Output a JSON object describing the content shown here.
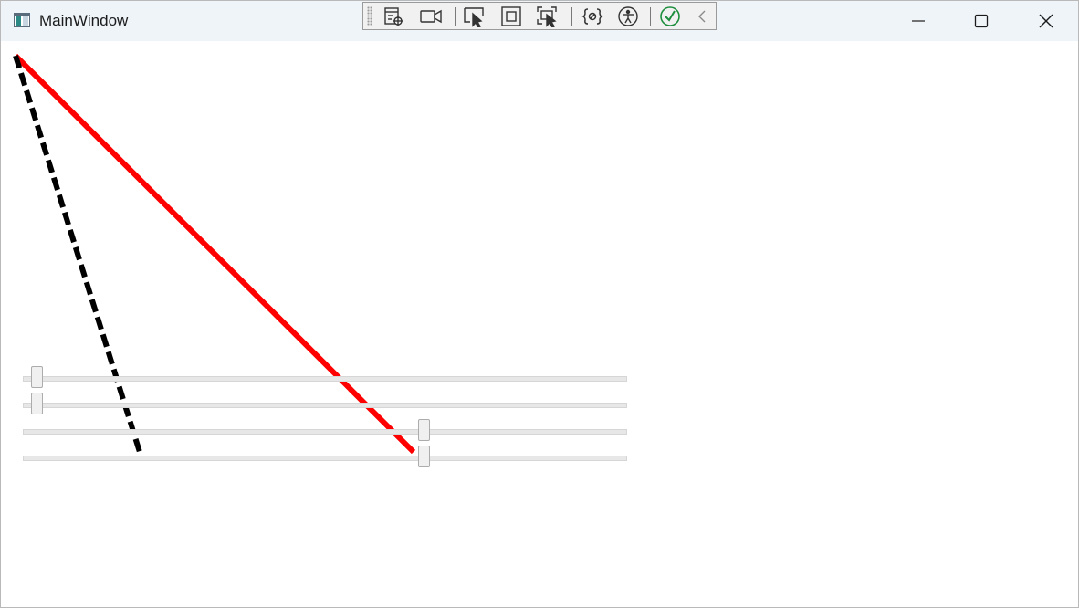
{
  "window": {
    "title": "MainWindow",
    "icon": "wpf-app-icon"
  },
  "caption_buttons": {
    "minimize": "minimize-icon",
    "maximize": "maximize-icon",
    "close": "close-icon"
  },
  "debug_toolbar": {
    "items": [
      "go-to-live-visual-tree-icon",
      "select-element-recording-icon",
      "select-element-icon",
      "display-layout-adorners-icon",
      "track-focused-element-icon",
      "binding-failures-icon",
      "accessibility-checker-icon",
      "hot-reload-status-icon",
      "collapse-toolbar-icon"
    ]
  },
  "lines": {
    "red_line_color": "#ff0000",
    "dashed_line_color": "#000000"
  },
  "sliders": [
    {
      "value": 0.0
    },
    {
      "value": 0.0
    },
    {
      "value": 0.667
    },
    {
      "value": 0.667
    }
  ]
}
